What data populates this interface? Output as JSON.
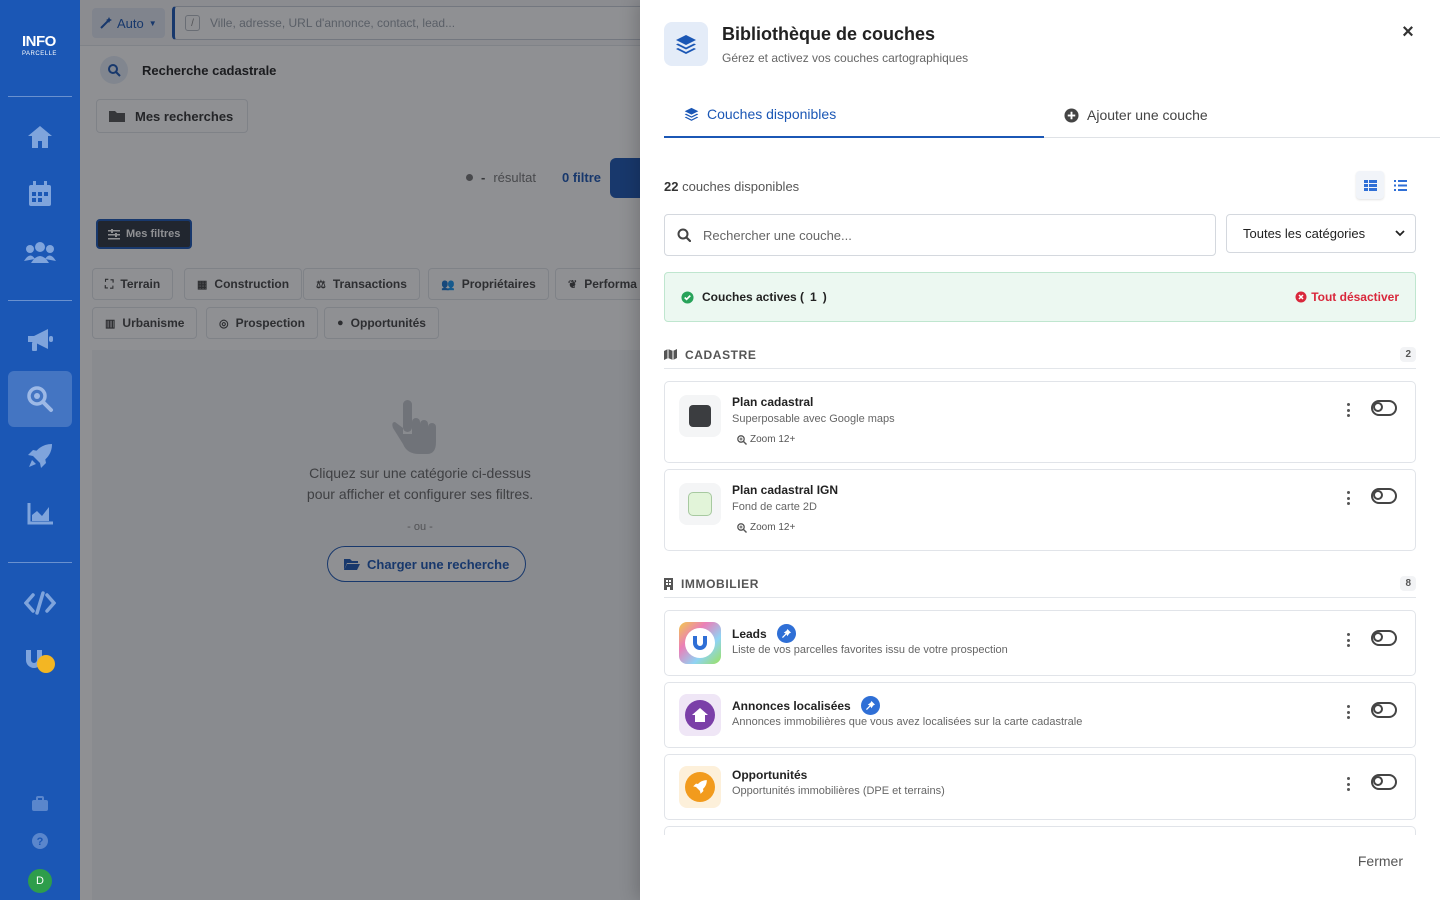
{
  "nav": {
    "logo_main": "INFO",
    "logo_sub": "PARCELLE",
    "avatar_letter": "D",
    "icons": [
      "home-icon",
      "calendar-icon",
      "users-icon",
      "megaphone-icon",
      "search-icon",
      "rocket-icon",
      "chart-icon",
      "code-icon",
      "magnet-icon",
      "toolbox-icon",
      "help-icon"
    ]
  },
  "topbar": {
    "mode_label": "Auto",
    "search_shortcut": "/",
    "search_placeholder": "Ville, adresse, URL d'annonce, contact, lead..."
  },
  "panel": {
    "search_title": "Recherche cadastrale",
    "my_searches": "Mes recherches",
    "result_dash": "-",
    "result_label": "résultat",
    "filter_count": "0 filtre",
    "my_filters": "Mes filtres",
    "chips_row1": [
      "Terrain",
      "Construction",
      "Transactions",
      "Propriétaires",
      "Performa"
    ],
    "chips_row2": [
      "Urbanisme",
      "Prospection",
      "Opportunités"
    ],
    "empty_line1": "Cliquez sur une catégorie ci-dessus",
    "empty_line2": "pour afficher et configurer ses filtres.",
    "or_label": "- ou -",
    "load_search": "Charger une recherche"
  },
  "drawer": {
    "title": "Bibliothèque de couches",
    "subtitle": "Gérez et activez vos couches cartographiques",
    "close_symbol": "×",
    "tabs": [
      {
        "label": "Couches disponibles",
        "active": true
      },
      {
        "label": "Ajouter une couche",
        "active": false
      }
    ],
    "count_number": "22",
    "count_label": "couches disponibles",
    "search_placeholder": "Rechercher une couche...",
    "category_select": "Toutes les catégories",
    "active_label": "Couches actives (",
    "active_count": "1",
    "active_close": ")",
    "deactivate_all": "Tout désactiver",
    "sections": [
      {
        "title": "CADASTRE",
        "count": "2"
      },
      {
        "title": "IMMOBILIER",
        "count": "8"
      }
    ],
    "layers": [
      {
        "name": "Plan cadastral",
        "desc": "Superposable avec Google maps",
        "zoom": "Zoom 12+",
        "on": false
      },
      {
        "name": "Plan cadastral IGN",
        "desc": "Fond de carte 2D",
        "zoom": "Zoom 12+",
        "on": false
      },
      {
        "name": "Leads",
        "desc": "Liste de vos parcelles favorites issu de votre prospection",
        "on": false
      },
      {
        "name": "Annonces localisées",
        "desc": "Annonces immobilières que vous avez localisées sur la carte cadastrale",
        "on": false
      },
      {
        "name": "Opportunités",
        "desc": "Opportunités immobilières (DPE et terrains)",
        "on": false
      }
    ],
    "footer_close": "Fermer"
  },
  "colors": {
    "primary": "#1b57b5",
    "success_bg": "#ecf8f1",
    "danger": "#d9283c"
  }
}
